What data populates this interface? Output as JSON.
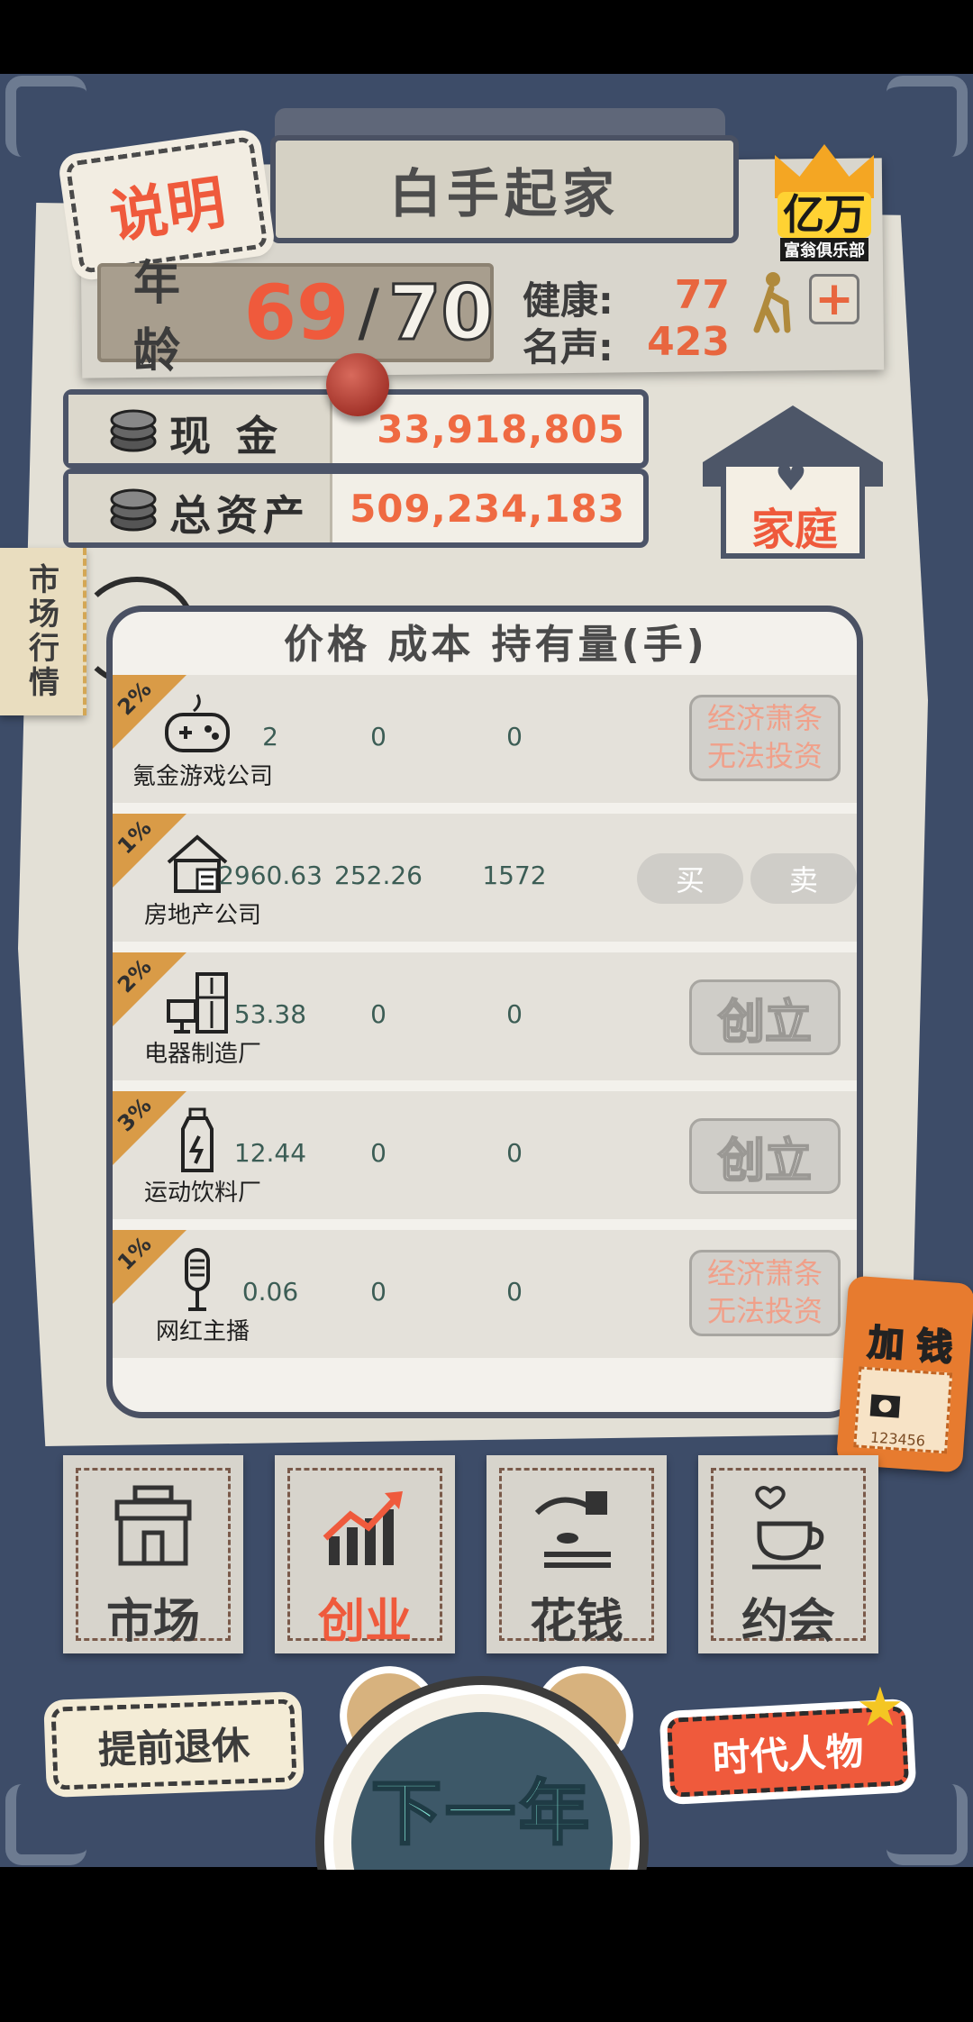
{
  "header": {
    "title": "白手起家",
    "explain_label": "说明",
    "club_main": "亿万",
    "club_sub": "富翁俱乐部"
  },
  "stats": {
    "age_label": "年龄",
    "age_current": "69",
    "age_separator": "/",
    "age_max": "70",
    "health_label": "健康:",
    "health_value": "77",
    "fame_label": "名声:",
    "fame_value": "423",
    "plus_label": "+"
  },
  "money": {
    "cash_label": "现 金",
    "cash_value": "33,918,805",
    "assets_label": "总资产",
    "assets_value": "509,234,183"
  },
  "family_label": "家庭",
  "market_tag": "市场行情",
  "list": {
    "header": "价格  成本  持有量(手)",
    "rows": [
      {
        "badge": "2%",
        "name": "氪金游戏公司",
        "price": "2",
        "cost": "0",
        "hold": "0",
        "action": "disabled",
        "action_line1": "经济萧条",
        "action_line2": "无法投资",
        "icon": "gamepad-icon"
      },
      {
        "badge": "1%",
        "name": "房地产公司",
        "price": "2960.63",
        "cost": "252.26",
        "hold": "1572",
        "action": "trade",
        "buy_label": "买",
        "sell_label": "卖",
        "icon": "house-icon"
      },
      {
        "badge": "2%",
        "name": "电器制造厂",
        "price": "53.38",
        "cost": "0",
        "hold": "0",
        "action": "found",
        "found_label": "创立",
        "icon": "appliance-icon"
      },
      {
        "badge": "3%",
        "name": "运动饮料厂",
        "price": "12.44",
        "cost": "0",
        "hold": "0",
        "action": "found",
        "found_label": "创立",
        "icon": "bottle-icon"
      },
      {
        "badge": "1%",
        "name": "网红主播",
        "price": "0.06",
        "cost": "0",
        "hold": "0",
        "action": "disabled",
        "action_line1": "经济萧条",
        "action_line2": "无法投资",
        "icon": "microphone-icon"
      }
    ]
  },
  "ticket": {
    "label": "加 钱",
    "serial": "123456"
  },
  "tabs": [
    {
      "label": "市场",
      "icon": "store-icon",
      "active": false
    },
    {
      "label": "创业",
      "icon": "growth-chart-icon",
      "active": true
    },
    {
      "label": "花钱",
      "icon": "spend-hand-icon",
      "active": false
    },
    {
      "label": "约会",
      "icon": "coffee-cup-icon",
      "active": false
    }
  ],
  "bottom": {
    "retire_label": "提前退休",
    "era_label": "时代人物",
    "next_year_label": "下一年"
  },
  "colors": {
    "accent": "#ef5a3c",
    "frame": "#3d4c68",
    "paper": "#e3e0d6",
    "value_orange": "#ef6a42",
    "table_text": "#3c5d55"
  }
}
